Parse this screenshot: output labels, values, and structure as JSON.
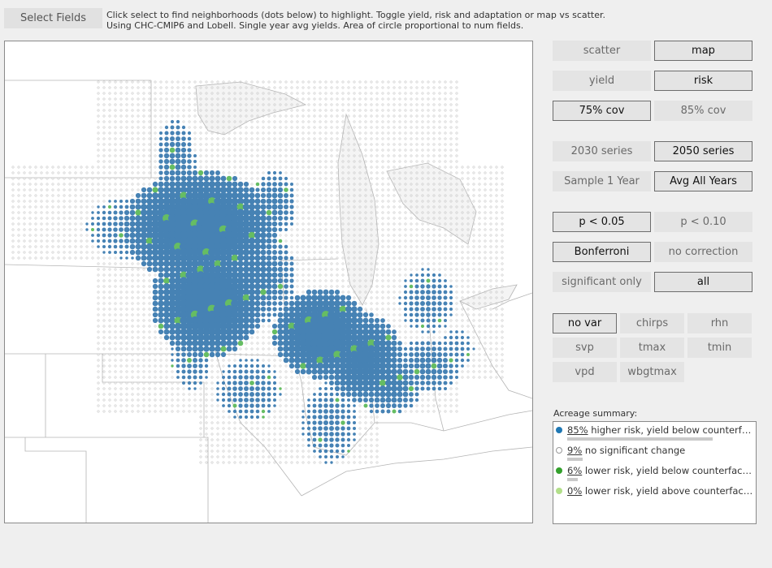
{
  "header": {
    "select_fields_label": "Select Fields",
    "instructions_line1": "Click select to find neighborhoods (dots below) to highlight. Toggle yield, risk and adaptation or map vs scatter.",
    "instructions_line2": "Using CHC-CMIP6 and Lobell. Single year avg yields. Area of circle proportional to num fields."
  },
  "controls": {
    "view": {
      "options": [
        "scatter",
        "map"
      ],
      "selected": "map"
    },
    "metric": {
      "options": [
        "yield",
        "risk"
      ],
      "selected": "risk"
    },
    "coverage": {
      "options": [
        "75% cov",
        "85% cov"
      ],
      "selected": "75% cov"
    },
    "series": {
      "options": [
        "2030 series",
        "2050 series"
      ],
      "selected": "2050 series"
    },
    "sample": {
      "options": [
        "Sample 1 Year",
        "Avg All Years"
      ],
      "selected": "Avg All Years"
    },
    "pvalue": {
      "options": [
        "p < 0.05",
        "p < 0.10"
      ],
      "selected": "p < 0.05"
    },
    "correction": {
      "options": [
        "Bonferroni",
        "no correction"
      ],
      "selected": "Bonferroni"
    },
    "filter": {
      "options": [
        "significant only",
        "all"
      ],
      "selected": "all"
    },
    "variables": {
      "options": [
        "no var",
        "chirps",
        "rhn",
        "svp",
        "tmax",
        "tmin",
        "vpd",
        "wbgtmax"
      ],
      "selected": "no var"
    }
  },
  "acreage": {
    "title": "Acreage summary:",
    "rows": [
      {
        "pct_label": "85%",
        "pct": 85,
        "text": " higher risk, yield below counterfactual",
        "color": "#1f78b4",
        "hollow": false
      },
      {
        "pct_label": "9%",
        "pct": 9,
        "text": " no significant change",
        "color": "#999999",
        "hollow": true
      },
      {
        "pct_label": "6%",
        "pct": 6,
        "text": " lower risk, yield below counterfactual",
        "color": "#33a02c",
        "hollow": false
      },
      {
        "pct_label": "0%",
        "pct": 0,
        "text": " lower risk, yield above counterfactual",
        "color": "#b2df8a",
        "hollow": false
      }
    ]
  },
  "map": {
    "colors": {
      "higher_risk": "#4682b4",
      "lower_risk": "#66bd63",
      "no_change": "#c8c8c8",
      "borders": "#b5b5b5",
      "lake_fill": "#f4f4f4"
    }
  }
}
